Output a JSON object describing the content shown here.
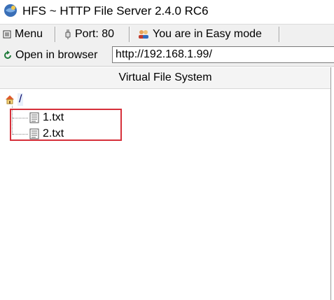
{
  "window": {
    "title": "HFS ~ HTTP File Server 2.4.0 RC6"
  },
  "toolbar": {
    "menu_label": "Menu",
    "port_label": "Port: 80",
    "mode_label": "You are in Easy mode"
  },
  "address": {
    "open_label": "Open in browser",
    "url": "http://192.168.1.99/"
  },
  "vfs": {
    "header": "Virtual File System",
    "root_label": "/",
    "items": [
      {
        "label": "1.txt"
      },
      {
        "label": "2.txt"
      }
    ]
  },
  "colors": {
    "highlight": "#d6303a",
    "toolbar_bg": "#f0f0f0"
  },
  "icons": {
    "app": "hfs-app-icon",
    "menu": "menu-icon",
    "port": "plug-icon",
    "mode": "users-icon",
    "open": "refresh-arrow-icon",
    "root": "home-icon",
    "file": "text-file-icon"
  }
}
